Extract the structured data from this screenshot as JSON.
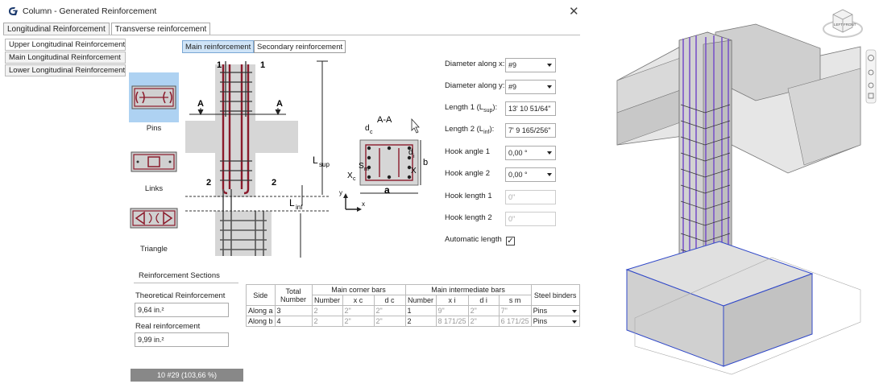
{
  "window": {
    "title": "Column - Generated Reinforcement",
    "close_symbol": "✕"
  },
  "tabs": [
    {
      "label": "Longitudinal Reinforcement",
      "active": true
    },
    {
      "label": "Transverse reinforcement",
      "active": false
    }
  ],
  "leftnav": [
    {
      "label": "Upper Longitudinal Reinforcement"
    },
    {
      "label": "Main Longitudinal Reinforcement"
    },
    {
      "label": "Lower Longitudinal Reinforcement"
    }
  ],
  "subtabs": {
    "main": "Main reinforcement",
    "secondary": "Secondary reinforcement"
  },
  "binder_types": {
    "pins": "Pins",
    "links": "Links",
    "triangle": "Triangle"
  },
  "drawing": {
    "section_1": "1",
    "section_2": "2",
    "section_a": "A",
    "l_sup": "L",
    "l_sup_sub": "sup",
    "l_inf": "L",
    "l_inf_sub": "inf",
    "axis_y": "y",
    "axis_x": "x",
    "section_title": "A-A",
    "dim_a": "a",
    "dim_b": "b",
    "dim_dc": "d",
    "dim_dc_sub": "c",
    "dim_di": "d",
    "dim_di_sub": "i",
    "dim_sm": "S",
    "dim_sm_sub": "m",
    "dim_xc": "X",
    "dim_xc_sub": "c",
    "dim_xi": "X"
  },
  "params": {
    "diameter_x_label": "Diameter along x:",
    "diameter_x_value": "#9",
    "diameter_y_label": "Diameter along y:",
    "diameter_y_value": "#9",
    "length1_label": "Length 1 (L",
    "length1_sub": "sup",
    "length1_suffix": "):",
    "length1_value": "13' 10 51/64\"",
    "length2_label": "Length 2 (L",
    "length2_sub": "inf",
    "length2_suffix": "):",
    "length2_value": "7' 9 165/256\"",
    "hook_angle1_label": "Hook angle 1",
    "hook_angle1_value": "0,00 °",
    "hook_angle2_label": "Hook angle 2",
    "hook_angle2_value": "0,00 °",
    "hook_length1_label": "Hook length 1",
    "hook_length1_value": "0\"",
    "hook_length2_label": "Hook length 2",
    "hook_length2_value": "0\"",
    "auto_length_label": "Automatic length",
    "auto_length_checked": true
  },
  "sections": {
    "title": "Reinforcement Sections",
    "theoretical_label": "Theoretical Reinforcement",
    "theoretical_value": "9,64 in.²",
    "real_label": "Real reinforcement",
    "real_value": "9,99 in.²"
  },
  "table": {
    "headers": {
      "side": "Side",
      "total_number": "Total Number",
      "corner": "Main corner bars",
      "intermediate": "Main intermediate bars",
      "binders": "Steel binders",
      "number": "Number",
      "xc": "x c",
      "dc": "d c",
      "xi": "x i",
      "di": "d i",
      "sm": "s m"
    },
    "rows": [
      {
        "side": "Along a",
        "total": "3",
        "corner_number": "2",
        "xc": "2\"",
        "dc": "2\"",
        "inter_number": "1",
        "xi": "9\"",
        "di": "2\"",
        "sm": "7\"",
        "binder": "Pins"
      },
      {
        "side": "Along b",
        "total": "4",
        "corner_number": "2",
        "xc": "2\"",
        "dc": "2\"",
        "inter_number": "2",
        "xi": "8 171/25",
        "di": "2\"",
        "sm": "6 171/25",
        "binder": "Pins"
      }
    ]
  },
  "summary": "10 #29   (103,66 %)",
  "viewcube": {
    "left": "LEFT",
    "front": "FRONT"
  },
  "colors": {
    "rebar_red": "#8b1a2b",
    "rebar_purple": "#7a55c8",
    "selection_blue": "#aed2f2",
    "concrete_gray": "#cfcfcf"
  }
}
